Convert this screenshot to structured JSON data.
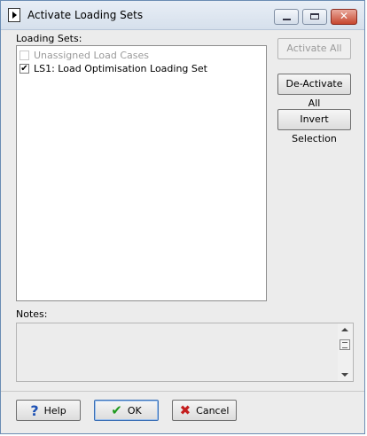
{
  "window": {
    "title": "Activate Loading Sets",
    "close_label": "✕"
  },
  "loading_sets": {
    "label": "Loading Sets:",
    "items": [
      {
        "label": "Unassigned Load Cases",
        "checked": false,
        "enabled": false
      },
      {
        "label": "LS1: Load Optimisation Loading Set",
        "checked": true,
        "enabled": true
      }
    ]
  },
  "actions": {
    "activate_all": "Activate All",
    "deactivate_all": "De-Activate All",
    "invert_selection": "Invert Selection"
  },
  "notes": {
    "label": "Notes:",
    "value": ""
  },
  "footer": {
    "help_label": "Help",
    "ok_label": "OK",
    "cancel_label": "Cancel"
  },
  "colors": {
    "help_icon": "#1e52b5",
    "ok_icon": "#1f9a1f",
    "cancel_icon": "#c41e1e"
  }
}
